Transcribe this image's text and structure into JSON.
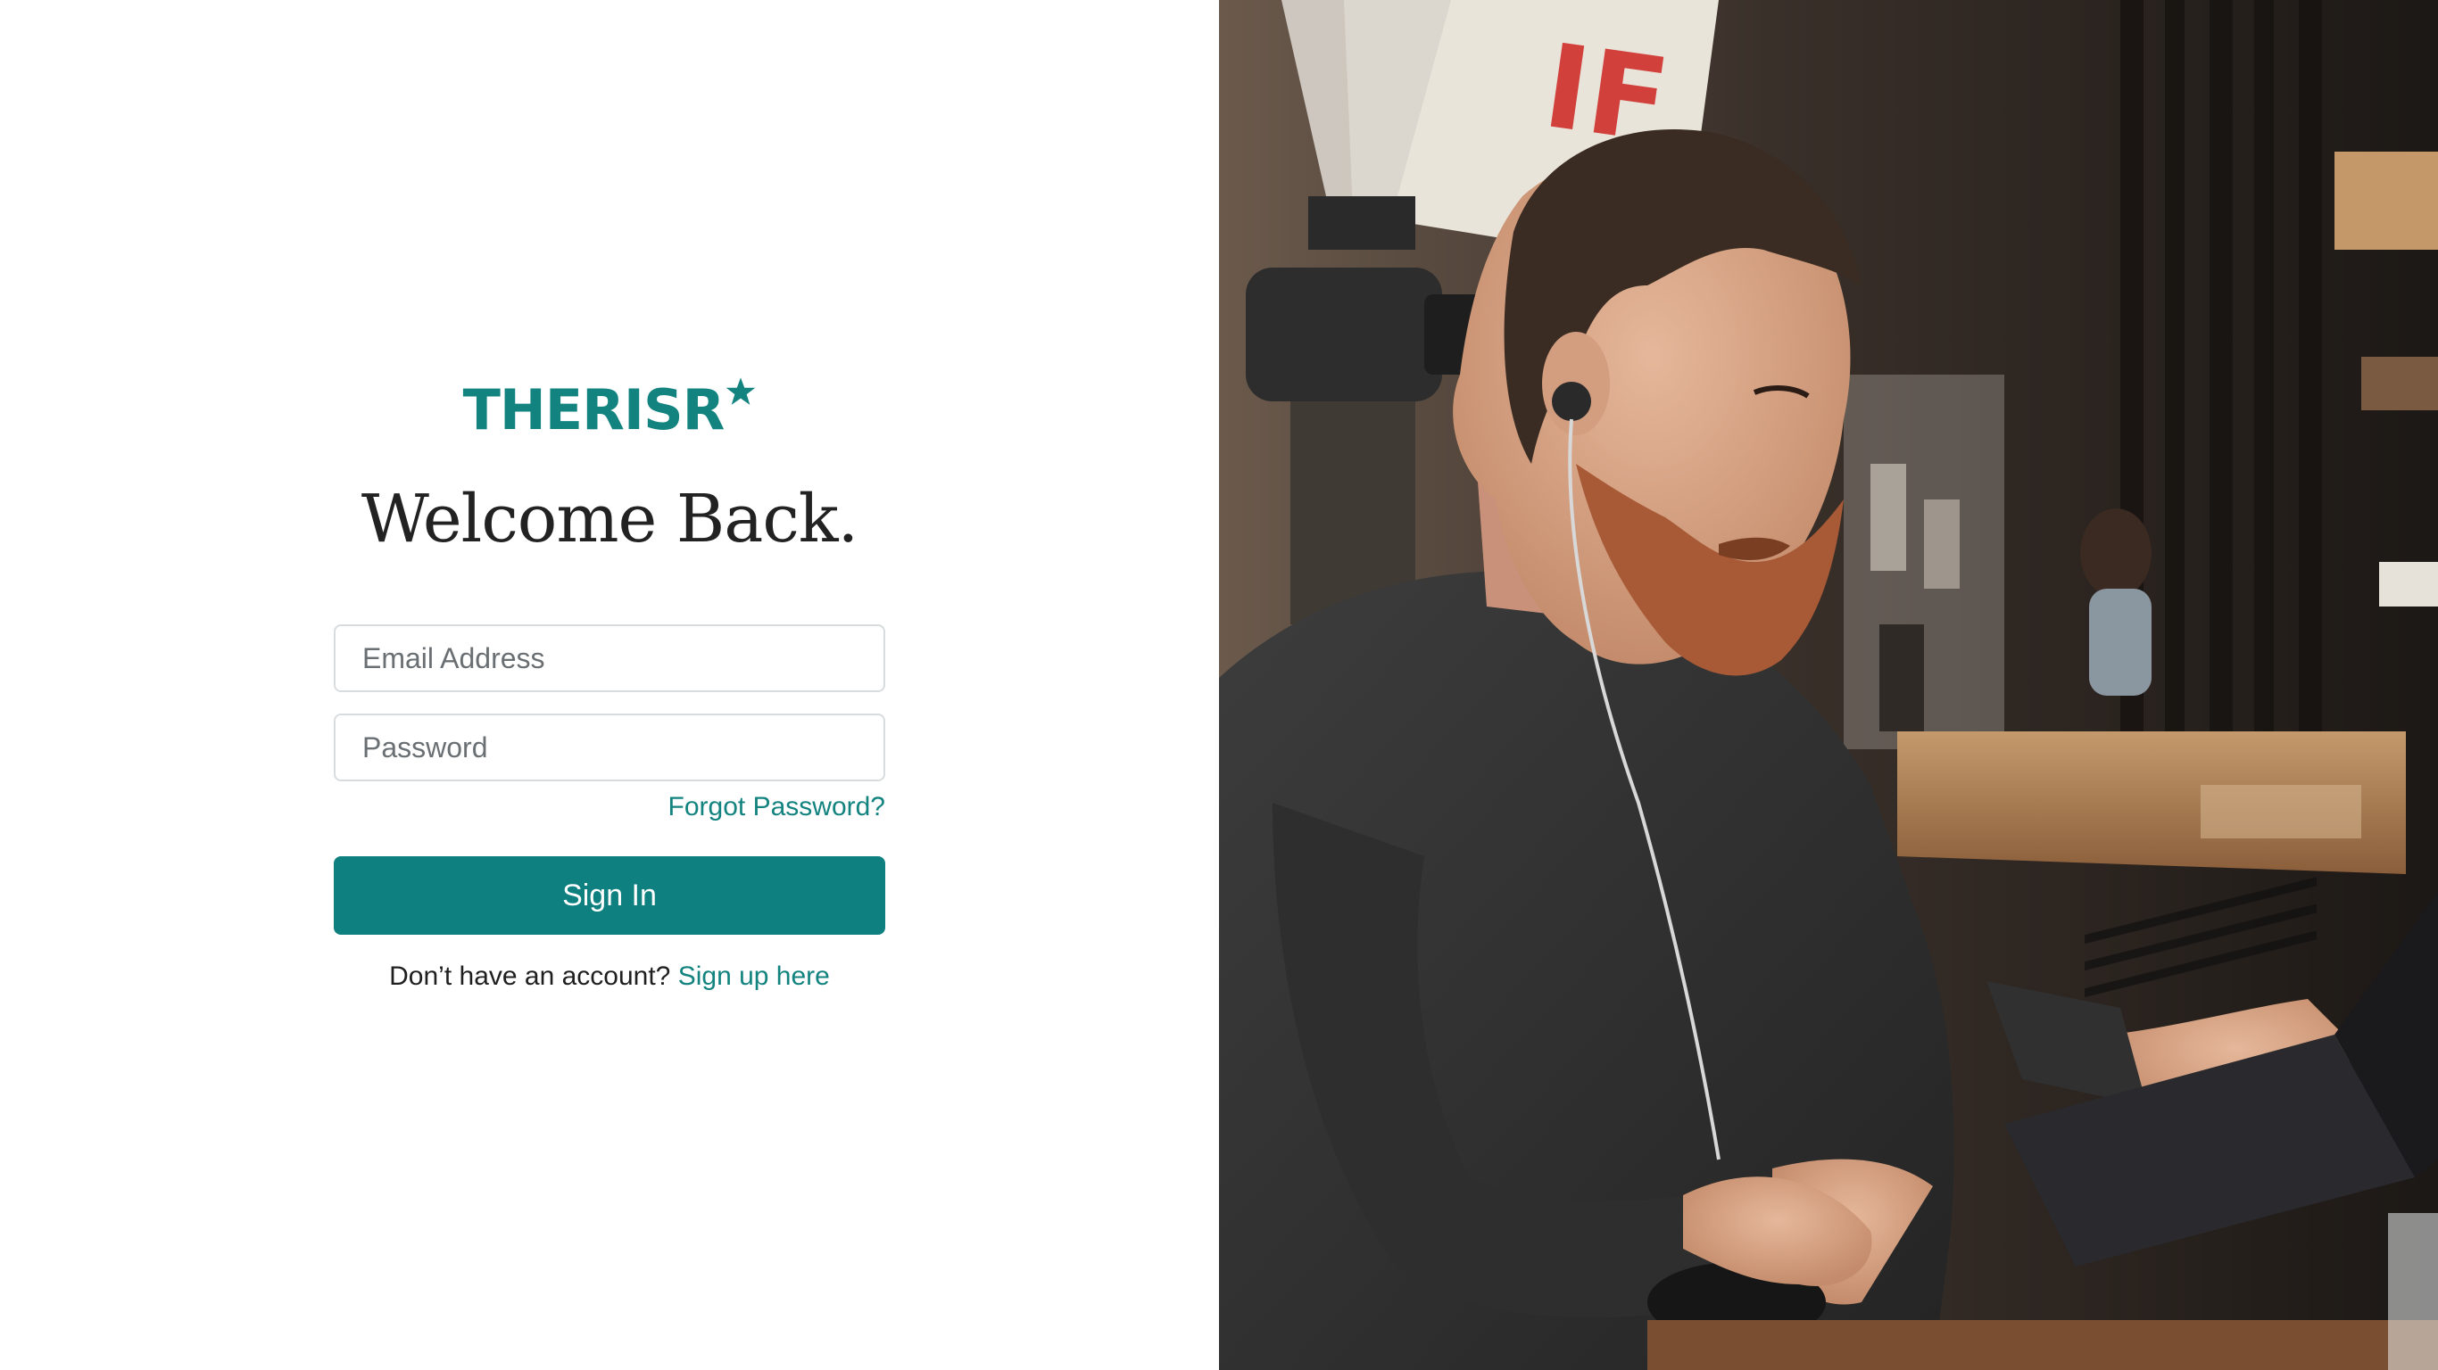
{
  "brand": {
    "name": "THERISR",
    "color": "#12837f"
  },
  "heading": "Welcome Back.",
  "form": {
    "email_placeholder": "Email Address",
    "password_placeholder": "Password",
    "forgot_password": "Forgot Password?",
    "submit_label": "Sign In"
  },
  "signup": {
    "prompt": "Don’t have an account?",
    "link_label": "Sign up here"
  },
  "hero_image": {
    "subject": "man with earphones typing on a laptop in a cafe",
    "sign_text": "IF"
  },
  "colors": {
    "primary_button": "#0e8080",
    "heading_text": "#222222",
    "input_border": "#d9dcde"
  }
}
